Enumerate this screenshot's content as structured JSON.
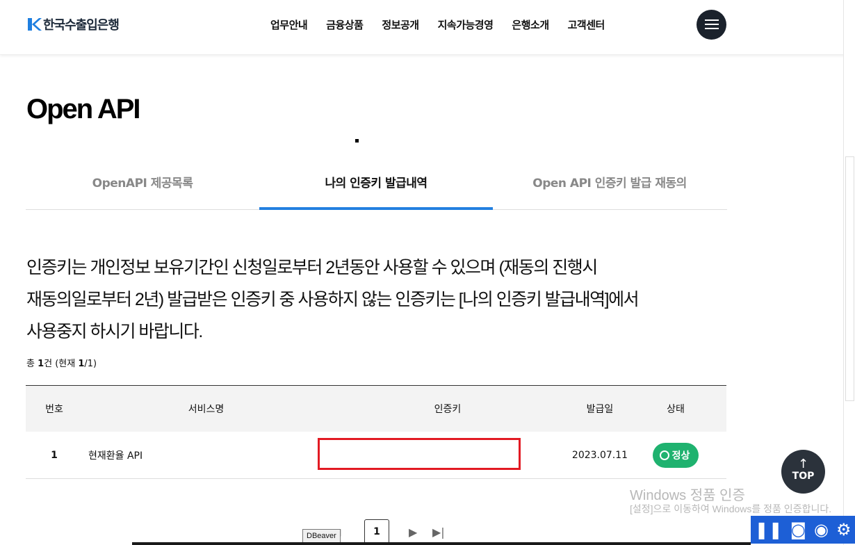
{
  "header": {
    "logo_text": "한국수출입은행",
    "nav": [
      "업무안내",
      "금융상품",
      "정보공개",
      "지속가능경영",
      "은행소개",
      "고객센터"
    ],
    "menu_icon": "hamburger-icon"
  },
  "page": {
    "title": "Open API"
  },
  "tabs": [
    {
      "label": "OpenAPI 제공목록"
    },
    {
      "label": "나의 인증키 발급내역",
      "active": true
    },
    {
      "label": "Open API 인증키 발급 재동의"
    }
  ],
  "notice": {
    "line1": "인증키는 개인정보 보유기간인 신청일로부터 2년동안 사용할 수 있으며 (재동의 진행시",
    "line2": "재동의일로부터 2년) 발급받은 인증키 중 사용하지 않는 인증키는 [나의 인증키 발급내역]에서",
    "line3": "사용중지 하시기 바랍니다."
  },
  "count": {
    "prefix": "총 ",
    "total": "1",
    "mid": "건 (현재 ",
    "current": "1",
    "suffix": "/1)"
  },
  "table": {
    "headers": {
      "no": "번호",
      "service": "서비스명",
      "key": "인증키",
      "date": "발급일",
      "state": "상태"
    },
    "rows": [
      {
        "no": "1",
        "service": "현재환율 API",
        "key": "",
        "date": "2023.07.11",
        "state": "정상"
      }
    ]
  },
  "top_button": {
    "label": "TOP"
  },
  "pagination": {
    "current": "1"
  },
  "tooltip": {
    "text": "DBeaver"
  },
  "watermark": {
    "line1": "Windows 정품 인증",
    "line2": "[설정]으로 이동하여 Windows를 정품 인증합니다."
  },
  "colors": {
    "accent": "#2380e0",
    "status_ok": "#1fb26f",
    "highlight_box": "#e21a23",
    "toolbar": "#1d5fd6"
  }
}
